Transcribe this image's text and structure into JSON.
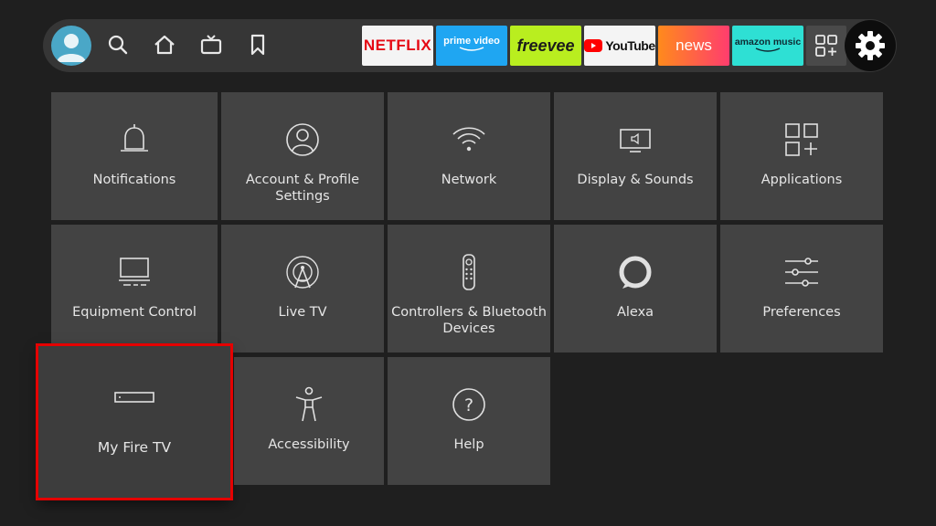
{
  "topbar": {
    "nav": [
      {
        "name": "profile-avatar"
      },
      {
        "name": "search-icon"
      },
      {
        "name": "home-icon"
      },
      {
        "name": "live-tv-icon"
      },
      {
        "name": "watchlist-bookmark-icon"
      }
    ],
    "apps": [
      {
        "label": "NETFLIX",
        "bg": "#f4f4f4",
        "fg": "#e50914"
      },
      {
        "label": "prime video",
        "bg": "#1fa6f2",
        "fg": "#ffffff"
      },
      {
        "label": "freevee",
        "bg": "#b9ee1f",
        "fg": "#1b1b1b"
      },
      {
        "label": "YouTube",
        "bg": "#f4f4f4",
        "fg": "#111111"
      },
      {
        "label": "news",
        "bg": "#ff6a1a",
        "fg": "#ffffff"
      },
      {
        "label": "amazon music",
        "bg": "#2ee0d4",
        "fg": "#0e2a33"
      }
    ]
  },
  "settings": {
    "tiles": [
      {
        "label": "Notifications",
        "icon": "bell-icon"
      },
      {
        "label": "Account & Profile Settings",
        "icon": "person-icon"
      },
      {
        "label": "Network",
        "icon": "wifi-icon"
      },
      {
        "label": "Display & Sounds",
        "icon": "tv-speaker-icon"
      },
      {
        "label": "Applications",
        "icon": "apps-grid-icon"
      },
      {
        "label": "Equipment Control",
        "icon": "monitor-icon"
      },
      {
        "label": "Live TV",
        "icon": "antenna-icon"
      },
      {
        "label": "Controllers & Bluetooth Devices",
        "icon": "remote-icon"
      },
      {
        "label": "Alexa",
        "icon": "alexa-ring-icon"
      },
      {
        "label": "Preferences",
        "icon": "sliders-icon"
      },
      {
        "label": "My Fire TV",
        "icon": "fire-tv-device-icon"
      },
      {
        "label": "Accessibility",
        "icon": "accessibility-icon"
      },
      {
        "label": "Help",
        "icon": "help-question-icon"
      }
    ]
  },
  "colors": {
    "focus_border": "#e50000",
    "tile_bg": "#434343"
  }
}
